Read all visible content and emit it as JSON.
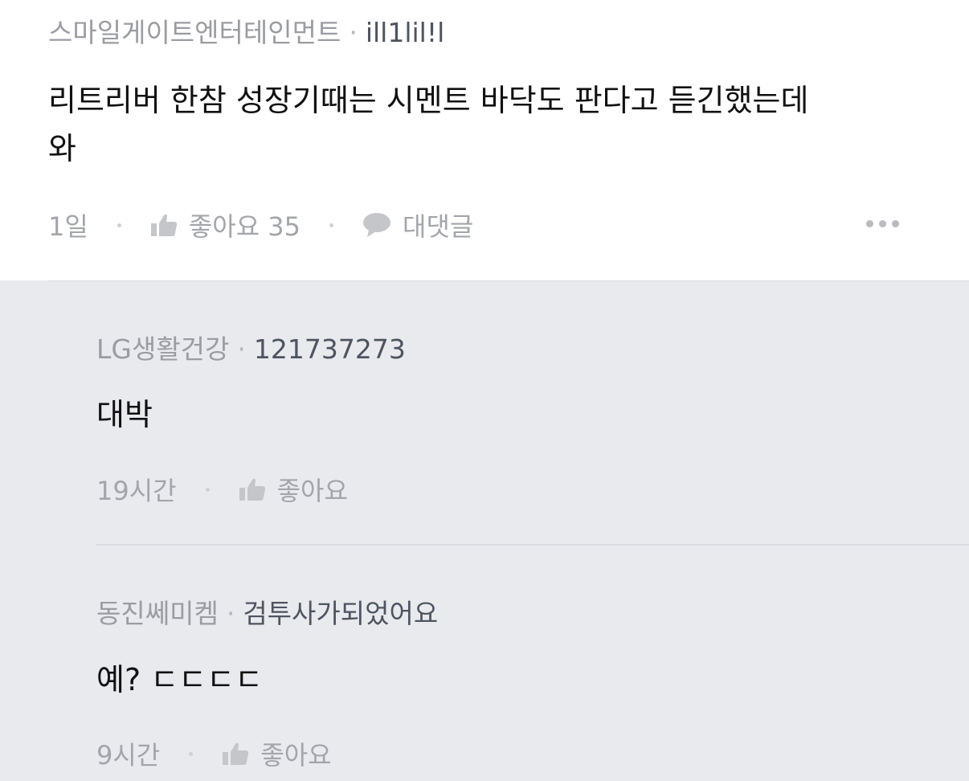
{
  "main_comment": {
    "author_name": "스마일게이트엔터테인먼트",
    "separator": "·",
    "author_id": "ill1lil!l",
    "text": "리트리버 한참 성장기때는 시멘트 바닥도 판다고 듣긴했는데\n와",
    "time": "1일",
    "like_label": "좋아요 35",
    "reply_label": "대댓글",
    "icons": {
      "like": "thumbs-up-icon",
      "reply": "speech-bubble-icon",
      "more": "more-options-icon"
    }
  },
  "replies": [
    {
      "author_name": "LG생활건강",
      "separator": "·",
      "author_id": "121737273",
      "text": "대박",
      "time": "19시간",
      "like_label": "좋아요"
    },
    {
      "author_name": "동진쎄미켐",
      "separator": "·",
      "author_id": "검투사가되었어요",
      "text": "예? ㄷㄷㄷㄷ",
      "time": "9시간",
      "like_label": "좋아요"
    }
  ],
  "colors": {
    "reply_background": "#e9eaee",
    "muted_text": "#a3a5aa",
    "author_id": "#4e5460",
    "body_text": "#111111"
  }
}
